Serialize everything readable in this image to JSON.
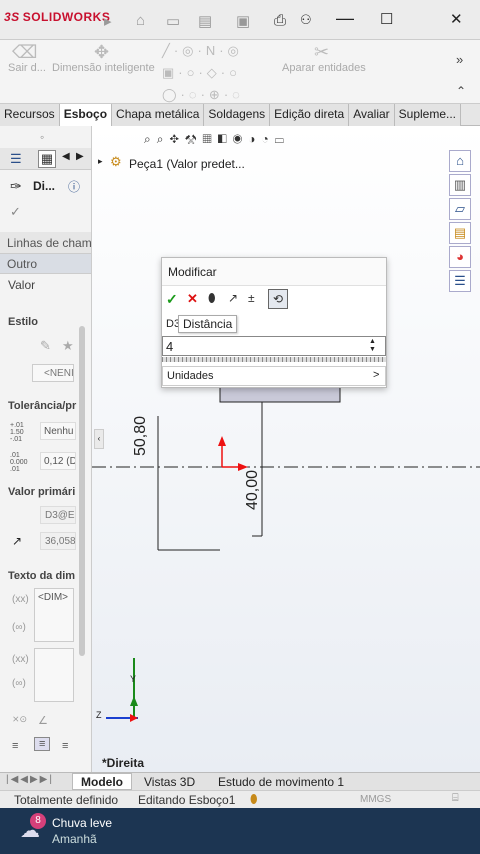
{
  "app": {
    "logo_prefix": "3S",
    "logo_name": "SOLIDWORKS"
  },
  "ribbon": {
    "exit_label": "Sair d...",
    "dim_label": "Dimensão inteligente",
    "snap_label": "Aparar entidades"
  },
  "tabs": [
    "Recursos",
    "Esboço",
    "Chapa metálica",
    "Soldagens",
    "Edição direta",
    "Avaliar",
    "Supleme..."
  ],
  "left_panel": {
    "title": "Di...",
    "sec_leader": "Linhas de chama",
    "sec_other": "Outro",
    "value_label": "Valor",
    "style_label": "Estilo",
    "style_value": "<NENI",
    "tol_label": "Tolerância/pr",
    "tol_value": "Nenhu",
    "prec_value": "0,12 (D",
    "primary_label": "Valor primári",
    "primary_name": "D3@E",
    "primary_value": "36,058",
    "dimtext_label": "Texto da dim",
    "dimtext_value": "<DIM>"
  },
  "tree": {
    "part": "Peça1 (Valor predet..."
  },
  "dialog": {
    "title": "Modificar",
    "name_prefix": "D3",
    "tooltip": "Distância",
    "input_value": "4",
    "units_label": "Unidades",
    "units_arrow": ">"
  },
  "sketch": {
    "dim1": "50,80",
    "dim2": "40,00",
    "view_label": "*Direita"
  },
  "bottom_tabs": [
    "Modelo",
    "Vistas 3D",
    "Estudo de movimento 1"
  ],
  "status": {
    "left": "Totalmente definido",
    "mid": "Editando Esboço1",
    "units": "MMGS"
  },
  "taskbar": {
    "badge": "8",
    "weather": "Chuva leve",
    "when": "Amanhã"
  },
  "colors": {
    "accent": "#c8102e",
    "taskbar": "#1c3552"
  }
}
